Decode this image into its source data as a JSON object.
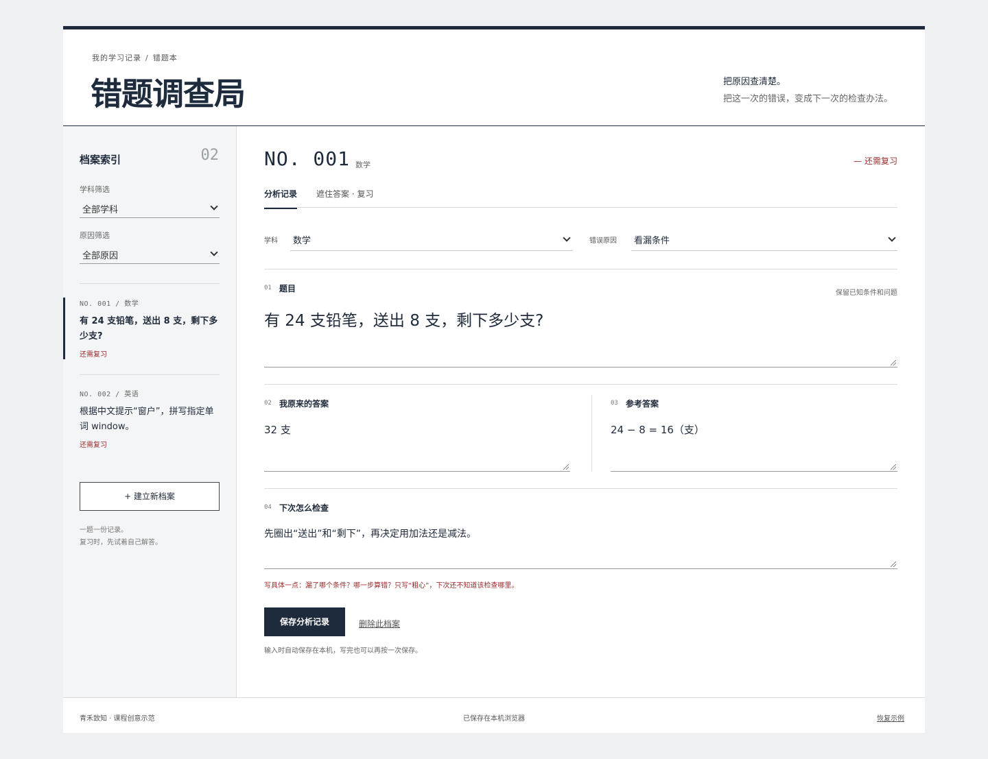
{
  "header": {
    "breadcrumb": [
      "我的学习记录",
      "错题本"
    ],
    "breadcrumb_sep": "/",
    "title": "错题调查局",
    "tagline": "把原因查清楚。",
    "subtagline": "把这一次的错误，变成下一次的检查办法。"
  },
  "sidebar": {
    "heading": "档案索引",
    "count": "02",
    "subject_filter": {
      "label": "学科筛选",
      "value": "全部学科"
    },
    "reason_filter": {
      "label": "原因筛选",
      "value": "全部原因"
    },
    "records": [
      {
        "meta": "NO. 001 / 数学",
        "text": "有 24 支铅笔，送出 8 支，剩下多少支?",
        "status": "还需复习",
        "active": true
      },
      {
        "meta": "NO. 002 / 英语",
        "text": "根据中文提示“窗户”，拼写指定单词 window。",
        "status": "还需复习",
        "active": false
      }
    ],
    "new_button": "+ 建立新档案",
    "note_line1": "一题一份记录。",
    "note_line2": "复习时，先试着自己解答。"
  },
  "main": {
    "record_no": "NO. 001",
    "subject_tag": "数学",
    "flag": "— 还需复习",
    "tabs": [
      "分析记录",
      "遮住答案 · 复习"
    ],
    "subject_label": "学科",
    "subject_value": "数学",
    "reason_label": "错误原因",
    "reason_value": "看漏条件",
    "q_no": "01",
    "q_title": "题目",
    "q_hint": "保留已知条件和问题",
    "q_text": "有 24 支铅笔，送出 8 支，剩下多少支?",
    "mine_no": "02",
    "mine_title": "我原来的答案",
    "mine_text": "32 支",
    "ref_no": "03",
    "ref_title": "参考答案",
    "ref_text": "24 − 8 = 16（支）",
    "next_no": "04",
    "next_title": "下次怎么检查",
    "next_text": "先圈出“送出”和“剩下”，再决定用加法还是减法。",
    "helper": "写具体一点：漏了哪个条件？哪一步算错？只写“粗心”，下次还不知道该检查哪里。",
    "save_label": "保存分析记录",
    "delete_label": "删除此档案",
    "autosave_note": "输入时自动保存在本机，写完也可以再按一次保存。"
  },
  "footer": {
    "left": "青禾致知 · 课程创意示范",
    "center": "已保存在本机浏览器",
    "right": "恢复示例"
  },
  "colors": {
    "navy": "#1e2b3c",
    "alert": "#9b2b2b"
  },
  "icons": {
    "select_arrow": "chevron-down-icon",
    "resize_handle": "resize-grip-icon"
  }
}
